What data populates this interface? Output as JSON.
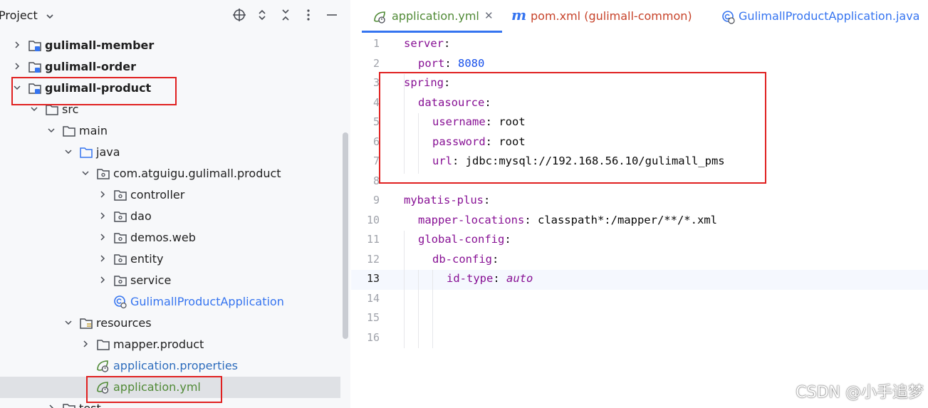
{
  "project_panel": {
    "title": "Project",
    "header_icons": [
      "crosshair-icon",
      "expand-collapse-icon",
      "collapse-all-icon",
      "more-icon",
      "minimize-icon"
    ],
    "tree": [
      {
        "label": "gulimall-member",
        "kind": "module",
        "expanded": false,
        "bold": true
      },
      {
        "label": "gulimall-order",
        "kind": "module",
        "expanded": false,
        "bold": true
      },
      {
        "label": "gulimall-product",
        "kind": "module",
        "expanded": true,
        "bold": true
      },
      {
        "label": "src",
        "kind": "folder",
        "expanded": true
      },
      {
        "label": "main",
        "kind": "folder",
        "expanded": true
      },
      {
        "label": "java",
        "kind": "source-folder",
        "expanded": true
      },
      {
        "label": "com.atguigu.gulimall.product",
        "kind": "package",
        "expanded": true
      },
      {
        "label": "controller",
        "kind": "package",
        "expanded": false
      },
      {
        "label": "dao",
        "kind": "package",
        "expanded": false
      },
      {
        "label": "demos.web",
        "kind": "package",
        "expanded": false
      },
      {
        "label": "entity",
        "kind": "package",
        "expanded": false
      },
      {
        "label": "service",
        "kind": "package",
        "expanded": false
      },
      {
        "label": "GulimallProductApplication",
        "kind": "spring-class"
      },
      {
        "label": "resources",
        "kind": "resources-folder",
        "expanded": true
      },
      {
        "label": "mapper.product",
        "kind": "folder",
        "expanded": false
      },
      {
        "label": "application.properties",
        "kind": "spring-config"
      },
      {
        "label": "application.yml",
        "kind": "spring-config",
        "selected": true
      },
      {
        "label": "test",
        "kind": "folder",
        "expanded": false
      }
    ]
  },
  "editor": {
    "tabs": [
      {
        "label": "application.yml",
        "icon": "spring-config-icon",
        "active": true,
        "closable": true,
        "color": "#508a36"
      },
      {
        "label": "pom.xml (gulimall-common)",
        "icon": "maven-icon",
        "active": false,
        "color": "#c7432a"
      },
      {
        "label": "GulimallProductApplication.java",
        "icon": "spring-class-icon",
        "active": false,
        "color": "#3574f0"
      }
    ],
    "current_line": 13,
    "lines": [
      {
        "n": "1",
        "indent": 0,
        "key": "server",
        "sep": ":",
        "value": "",
        "vtype": ""
      },
      {
        "n": "2",
        "indent": 1,
        "key": "port",
        "sep": ": ",
        "value": "8080",
        "vtype": "num"
      },
      {
        "n": "3",
        "indent": 0,
        "key": "spring",
        "sep": ":",
        "value": "",
        "vtype": ""
      },
      {
        "n": "4",
        "indent": 1,
        "key": "datasource",
        "sep": ":",
        "value": "",
        "vtype": ""
      },
      {
        "n": "5",
        "indent": 2,
        "key": "username",
        "sep": ": ",
        "value": "root",
        "vtype": "plain"
      },
      {
        "n": "6",
        "indent": 2,
        "key": "password",
        "sep": ": ",
        "value": "root",
        "vtype": "plain"
      },
      {
        "n": "7",
        "indent": 2,
        "key": "url",
        "sep": ": ",
        "value": "jdbc:mysql://192.168.56.10/gulimall_pms",
        "vtype": "plain"
      },
      {
        "n": "8",
        "indent": 0,
        "key": "",
        "sep": "",
        "value": "",
        "vtype": ""
      },
      {
        "n": "9",
        "indent": 0,
        "key": "mybatis-plus",
        "sep": ":",
        "value": "",
        "vtype": ""
      },
      {
        "n": "10",
        "indent": 1,
        "key": "mapper-locations",
        "sep": ": ",
        "value": "classpath*:/mapper/**/*.xml",
        "vtype": "plain"
      },
      {
        "n": "11",
        "indent": 1,
        "key": "global-config",
        "sep": ":",
        "value": "",
        "vtype": ""
      },
      {
        "n": "12",
        "indent": 2,
        "key": "db-config",
        "sep": ":",
        "value": "",
        "vtype": ""
      },
      {
        "n": "13",
        "indent": 3,
        "key": "id-type",
        "sep": ": ",
        "value": "auto",
        "vtype": "italic"
      },
      {
        "n": "14",
        "indent": 0,
        "key": "",
        "sep": "",
        "value": "",
        "vtype": ""
      },
      {
        "n": "15",
        "indent": 0,
        "key": "",
        "sep": "",
        "value": "",
        "vtype": ""
      },
      {
        "n": "16",
        "indent": 0,
        "key": "",
        "sep": "",
        "value": "",
        "vtype": ""
      }
    ]
  },
  "colors": {
    "highlight_box": "#e02020",
    "accent": "#3574f0",
    "yaml_key": "#871094",
    "yaml_number": "#1750eb"
  },
  "watermark": "CSDN @小手追梦"
}
